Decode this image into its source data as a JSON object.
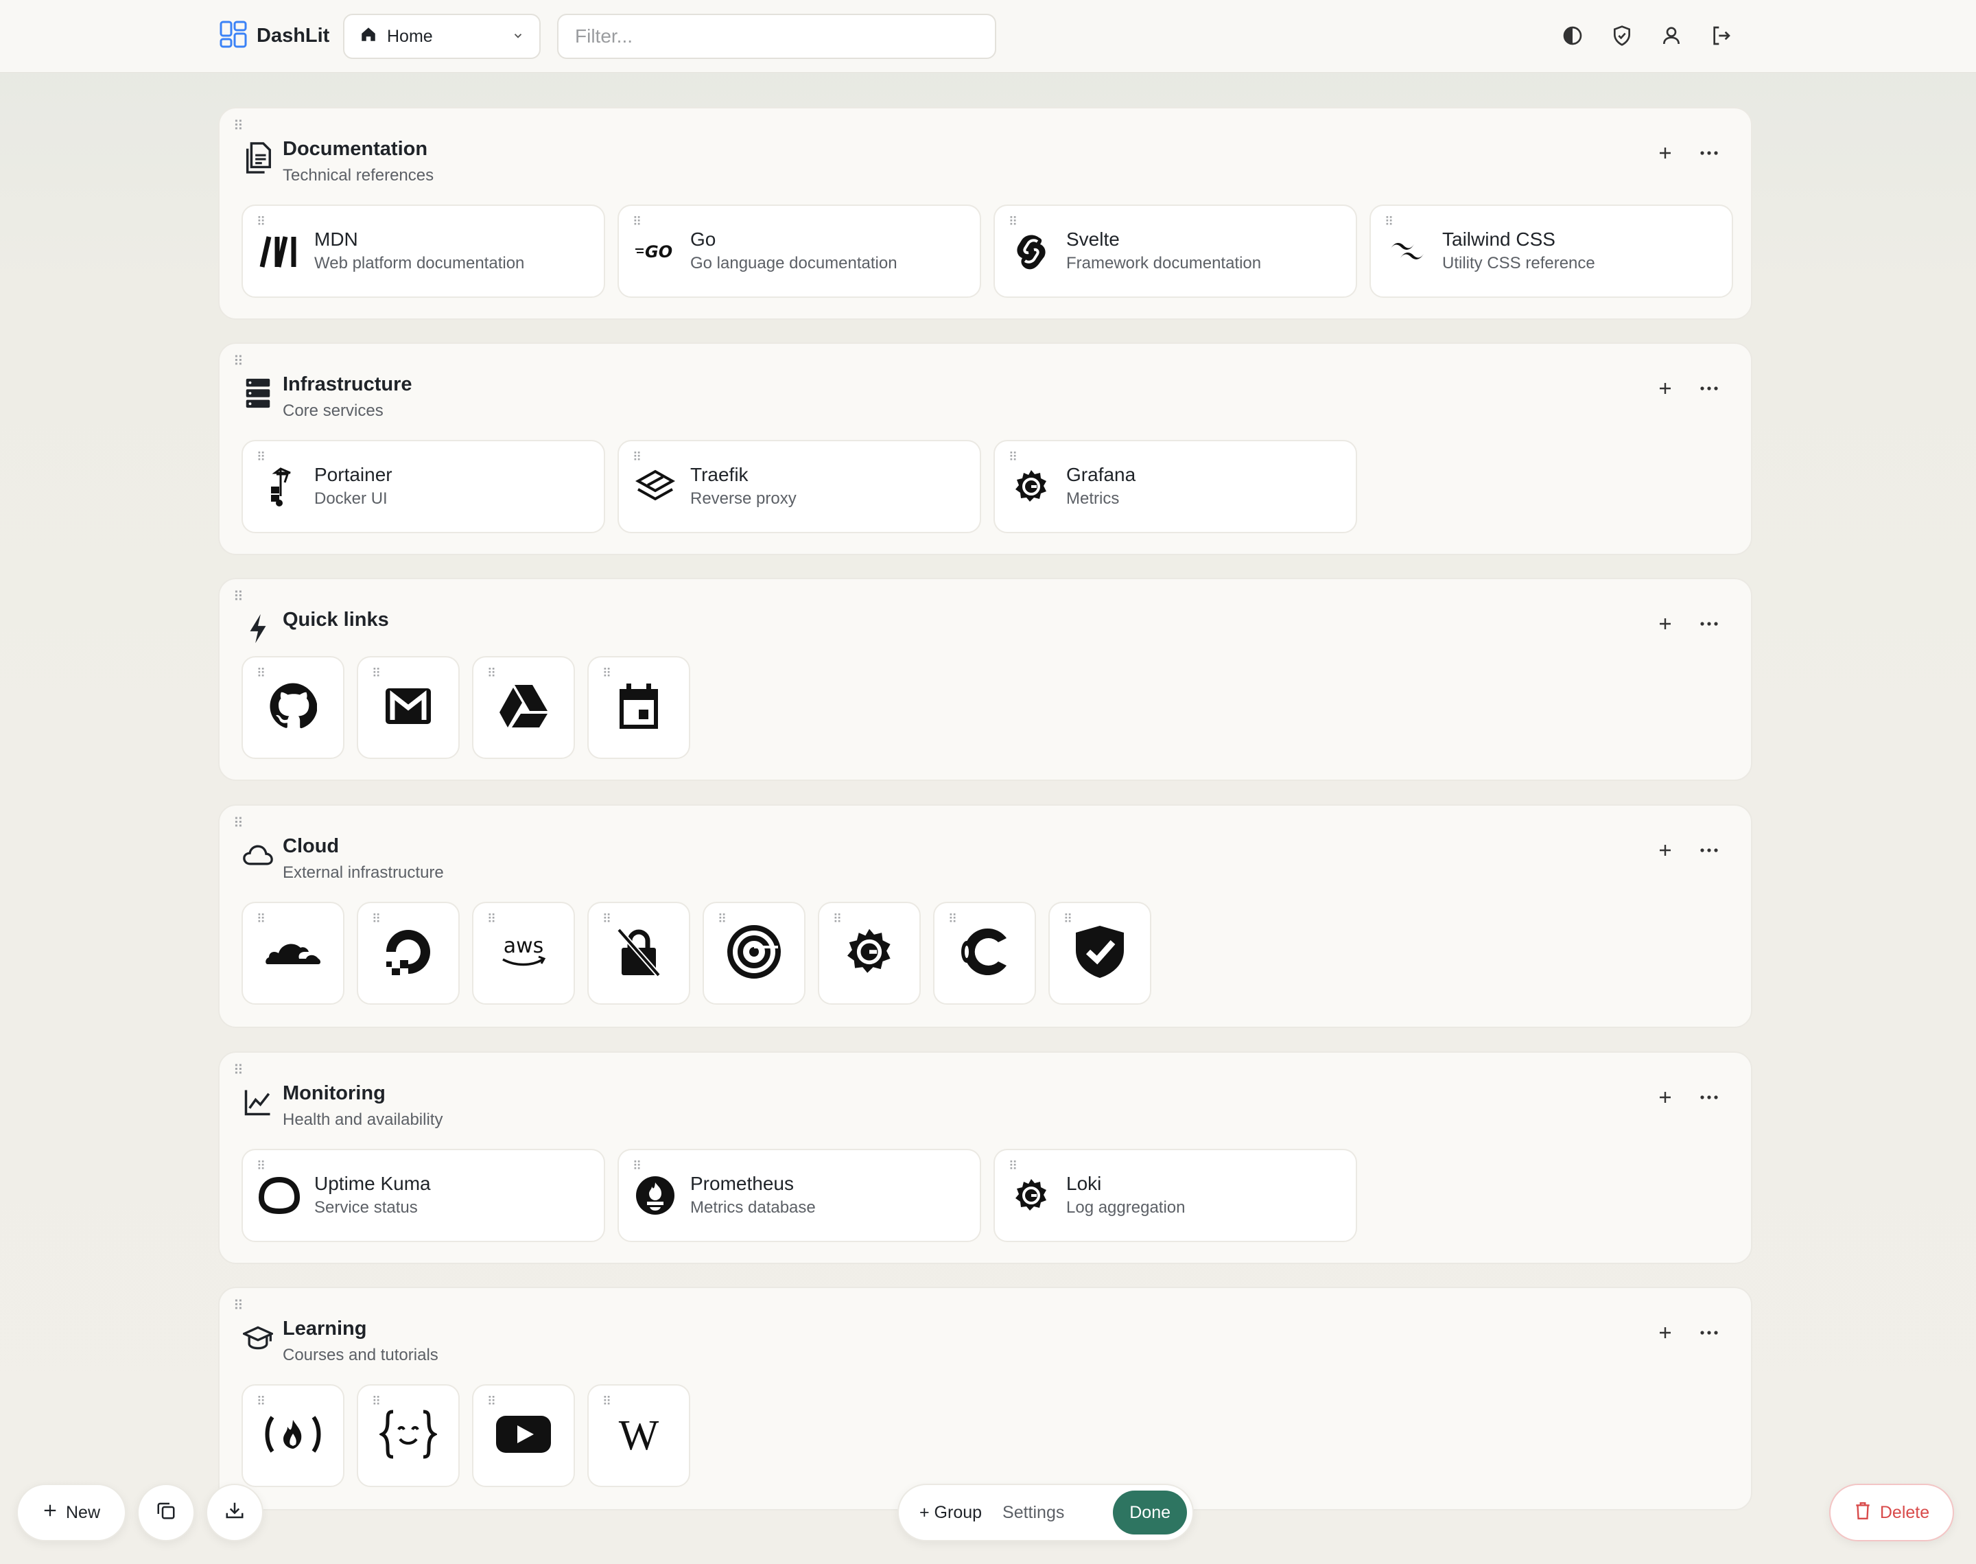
{
  "app": {
    "name": "DashLit"
  },
  "header": {
    "page_select": {
      "value": "Home"
    },
    "filter": {
      "placeholder": "Filter...",
      "value": ""
    },
    "icons": [
      "theme-toggle-icon",
      "shield-icon",
      "user-icon",
      "logout-icon"
    ]
  },
  "groups": [
    {
      "title": "Documentation",
      "subtitle": "Technical references",
      "icon": "document-icon",
      "items": [
        {
          "title": "MDN",
          "subtitle": "Web platform documentation",
          "icon": "mdn-icon"
        },
        {
          "title": "Go",
          "subtitle": "Go language documentation",
          "icon": "go-icon"
        },
        {
          "title": "Svelte",
          "subtitle": "Framework documentation",
          "icon": "svelte-icon"
        },
        {
          "title": "Tailwind CSS",
          "subtitle": "Utility CSS reference",
          "icon": "tailwind-icon"
        }
      ]
    },
    {
      "title": "Infrastructure",
      "subtitle": "Core services",
      "icon": "server-icon",
      "items": [
        {
          "title": "Portainer",
          "subtitle": "Docker UI",
          "icon": "portainer-icon"
        },
        {
          "title": "Traefik",
          "subtitle": "Reverse proxy",
          "icon": "traefik-icon"
        },
        {
          "title": "Grafana",
          "subtitle": "Metrics",
          "icon": "grafana-icon"
        }
      ]
    },
    {
      "title": "Quick links",
      "subtitle": "",
      "icon": "lightning-icon",
      "tiles": [
        "github-icon",
        "gmail-icon",
        "google-drive-icon",
        "calendar-icon"
      ]
    },
    {
      "title": "Cloud",
      "subtitle": "External infrastructure",
      "icon": "cloud-icon",
      "tiles": [
        "cloudflare-icon",
        "digitalocean-icon",
        "aws-icon",
        "lock-off-icon",
        "spiral-icon",
        "grafana-icon",
        "c-logo-icon",
        "shield-check-icon"
      ]
    },
    {
      "title": "Monitoring",
      "subtitle": "Health and availability",
      "icon": "chart-line-icon",
      "items": [
        {
          "title": "Uptime Kuma",
          "subtitle": "Service status",
          "icon": "uptime-kuma-icon"
        },
        {
          "title": "Prometheus",
          "subtitle": "Metrics database",
          "icon": "prometheus-icon"
        },
        {
          "title": "Loki",
          "subtitle": "Log aggregation",
          "icon": "grafana-icon"
        }
      ]
    },
    {
      "title": "Learning",
      "subtitle": "Courses and tutorials",
      "icon": "graduation-cap-icon",
      "tiles": [
        "freecodecamp-icon",
        "braces-icon",
        "youtube-icon",
        "wikipedia-icon"
      ]
    }
  ],
  "tiles_text": {
    "aws": "aws",
    "wikipedia": "W",
    "fcc": "( )",
    "braces": "{ }"
  },
  "bottom": {
    "new_label": "New",
    "group_label": "+ Group",
    "settings_label": "Settings",
    "done_label": "Done",
    "delete_label": "Delete"
  },
  "colors": {
    "accent": "#2e7561",
    "danger": "#d84a4a"
  }
}
